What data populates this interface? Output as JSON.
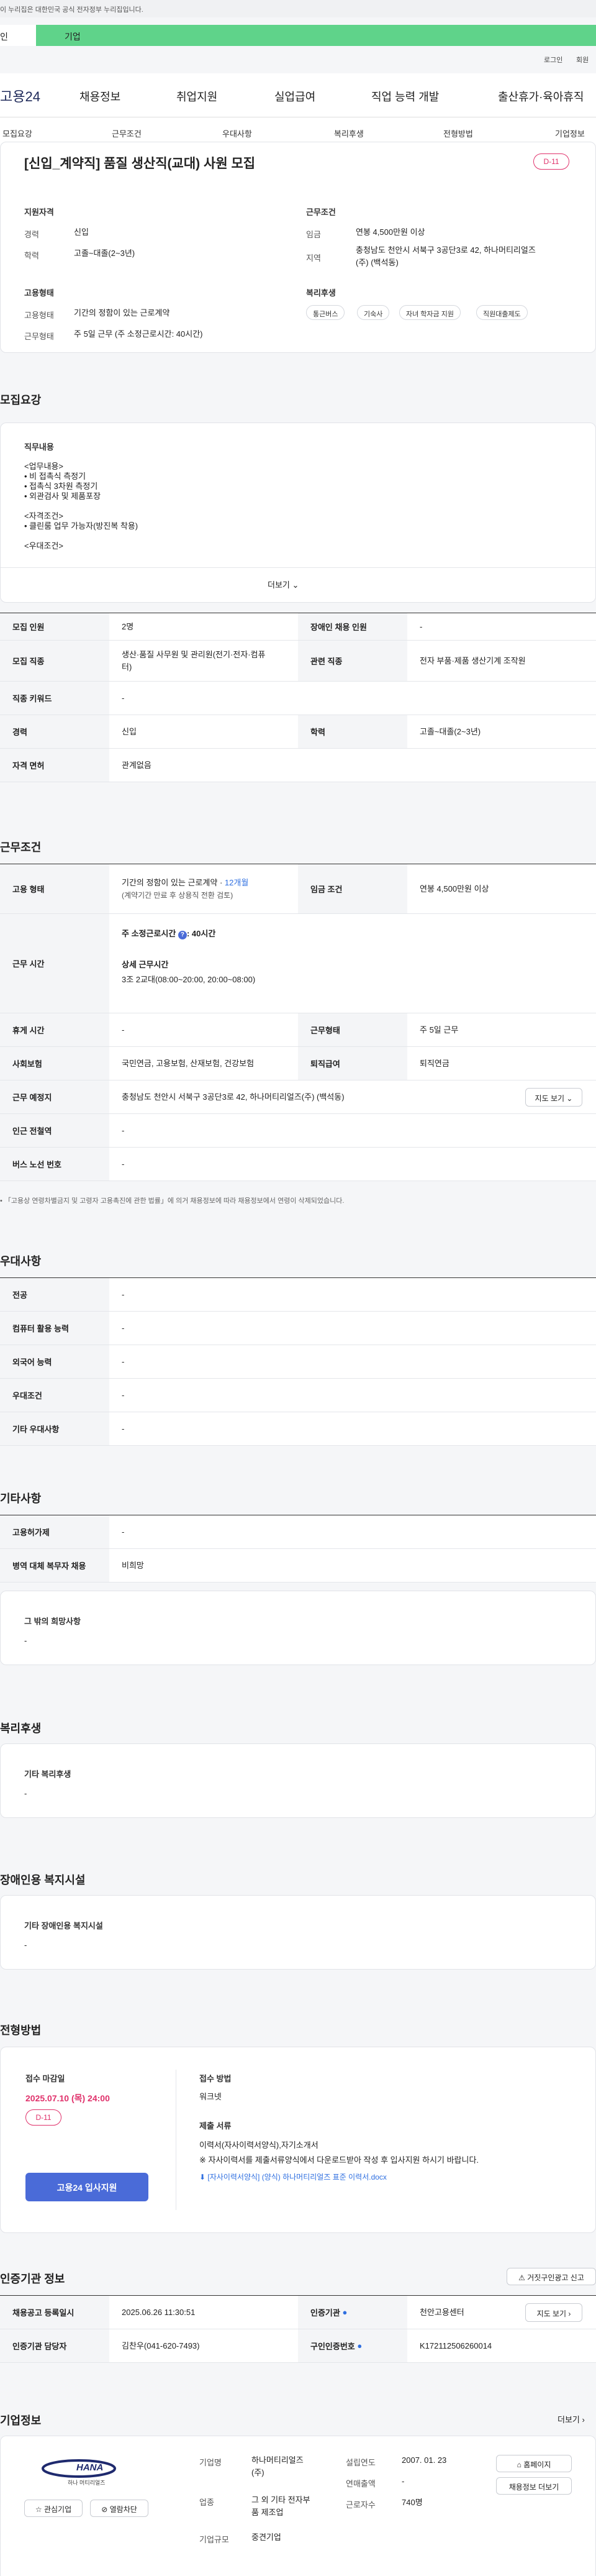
{
  "notice": "이 누리집은 대한민국 공식 전자정부 누리집입니다.",
  "banner": {
    "left": "인",
    "right": "기업"
  },
  "util": {
    "login": "로그인",
    "join": "회원"
  },
  "gnb": {
    "logo": "고용24",
    "items": [
      "채용정보",
      "취업지원",
      "실업급여",
      "직업 능력 개발",
      "출산휴가·육아휴직"
    ]
  },
  "tabs": [
    "모집요강",
    "근무조건",
    "우대사항",
    "복리후생",
    "전형방법",
    "기업정보"
  ],
  "job": {
    "title": "[신입_계약직] 품질 생산직(교대) 사원 모집",
    "dday": "D-11",
    "qual": {
      "heading": "지원자격",
      "career_k": "경력",
      "career_v": "신입",
      "edu_k": "학력",
      "edu_v": "고졸~대졸(2~3년)"
    },
    "cond": {
      "heading": "근무조건",
      "wage_k": "임금",
      "wage_v": "연봉 4,500만원 이상",
      "loc_k": "지역",
      "loc_v1": "충청남도 천안시 서북구 3공단3로 42, 하나머티리얼즈",
      "loc_v2": "(주) (백석동)"
    },
    "emp": {
      "heading": "고용형태",
      "type_k": "고용형태",
      "type_v": "기간의 정함이 있는 근로계약",
      "hours_k": "근무형태",
      "hours_v": "주 5일 근무 (주 소정근로시간: 40시간)"
    },
    "welfare": {
      "heading": "복리후생",
      "chips": [
        "통근버스",
        "기숙사",
        "자녀 학자금 지원",
        "직원대출제도"
      ]
    }
  },
  "recruit": {
    "heading": "모집요강",
    "duty_heading": "직무내용",
    "lines": [
      "<업무내용>",
      "• 비 접촉식 측정기",
      "• 접촉식 3차원 측정기",
      "• 외관검사 및 제품포장",
      "",
      "<자격조건>",
      "• 클린룸 업무 가능자(방진복 착용)",
      "",
      "<우대조건>"
    ],
    "more": "더보기"
  },
  "t1": {
    "count_k": "모집 인원",
    "count_v": "2명",
    "disab_k": "장애인 채용 인원",
    "disab_v": "-",
    "job_k": "모집 직종",
    "job_v1": "생산·품질 사무원 및 관리원(전기·전자·컴퓨",
    "job_v2": "터)",
    "rel_k": "관련 직종",
    "rel_v": "전자 부품·제품 생산기계 조작원",
    "kw_k": "직종 키워드",
    "kw_v": "-",
    "career_k": "경력",
    "career_v": "신입",
    "edu_k": "학력",
    "edu_v": "고졸~대졸(2~3년)",
    "lic_k": "자격 면허",
    "lic_v": "관계없음"
  },
  "work": {
    "heading": "근무조건",
    "type_k": "고용 형태",
    "type_v1": "기간의 정함이 있는 근로계약 · ",
    "type_months": "12개월",
    "type_v2": "(계약기간 만료 후 상용직 전환 검토)",
    "wage_k": "임금 조건",
    "wage_v": "연봉 4,500만원 이상",
    "time_k": "근무 시간",
    "time_std": "주 소정근로시간",
    "time_std_v": ": 40시간",
    "time_detail_h": "상세 근무시간",
    "time_detail_v": "3조 2교대(08:00~20:00, 20:00~08:00)",
    "rest_k": "휴게 시간",
    "rest_v": "-",
    "form_k": "근무형태",
    "form_v": "주 5일 근무",
    "ins_k": "사회보험",
    "ins_v": "국민연금, 고용보험, 산재보험, 건강보험",
    "ret_k": "퇴직급여",
    "ret_v": "퇴직연금",
    "addr_k": "근무 예정지",
    "addr_v": "충청남도 천안시 서북구 3공단3로 42, 하나머티리얼즈(주) (백석동)",
    "map_btn": "지도 보기",
    "sub_k": "인근 전철역",
    "sub_v": "-",
    "bus_k": "버스 노선 번호",
    "bus_v": "-",
    "note": "「고용상 연령차별금지 및 고령자 고용촉진에 관한 법률」에 의거 채용정보에 따라 채용정보에서 연령이 삭제되었습니다."
  },
  "pref": {
    "heading": "우대사항",
    "major_k": "전공",
    "major_v": "-",
    "pc_k": "컴퓨터 활용 능력",
    "pc_v": "-",
    "lang_k": "외국어 능력",
    "lang_v": "-",
    "cond_k": "우대조건",
    "cond_v": "-",
    "etc_k": "기타 우대사항",
    "etc_v": "-"
  },
  "other": {
    "heading": "기타사항",
    "ins_k": "고용허가제",
    "ins_v": "-",
    "mil_k": "병역 대체 복무자 채용",
    "mil_v": "비희망",
    "req_h": "그 밖의 희망사항",
    "req_v": "-"
  },
  "benefit": {
    "heading": "복리후생",
    "h": "기타 복리후생",
    "v": "-"
  },
  "disab": {
    "heading": "장애인용 복지시설",
    "h": "기타 장애인용 복지시설",
    "v": "-"
  },
  "apply": {
    "heading": "전형방법",
    "deadline_h": "접수 마감일",
    "deadline_v": "2025.07.10 (목) 24:00",
    "dday": "D-11",
    "apply_btn": "고용24 입사지원",
    "method_h": "접수 방법",
    "method_v": "워크넷",
    "docs_h": "제출 서류",
    "docs_v1": "이력서(자사이력서양식),자기소개서",
    "docs_v2": "※ 자사이력서를 제출서류양식에서 다운로드받아 작성 후 입사지원 하시기 바랍니다.",
    "file": "[자사이력서양식] (양식) 하나머티리얼즈 표준 이력서.docx"
  },
  "auth": {
    "heading": "인증기관 정보",
    "report_btn": "거짓구인광고 신고",
    "reg_k": "채용공고 등록일시",
    "reg_v": "2025.06.26 11:30:51",
    "org_k": "인증기관",
    "org_v": "천안고용센터",
    "map_btn": "지도 보기",
    "mgr_k": "인증기관 담당자",
    "mgr_v": "김찬우(041-620-7493)",
    "no_k": "구인인증번호",
    "no_v": "K172112506260014"
  },
  "company": {
    "heading": "기업정보",
    "more": "더보기",
    "logo": "HANA",
    "logo_sub": "하나 머티리얼즈",
    "fav_btn": "관심기업",
    "block_btn": "열람차단",
    "name_k": "기업명",
    "name_v1": "하나머티리얼즈",
    "name_v2": "(주)",
    "ind_k": "업종",
    "ind_v1": "그 외 기타 전자부",
    "ind_v2": "품 제조업",
    "size_k": "기업규모",
    "size_v": "중견기업",
    "est_k": "설립연도",
    "est_v": "2007. 01. 23",
    "sales_k": "연매출액",
    "sales_v": "-",
    "emp_k": "근로자수",
    "emp_v": "740명",
    "home_btn": "홈페이지",
    "jobs_btn": "채용정보 더보기"
  }
}
